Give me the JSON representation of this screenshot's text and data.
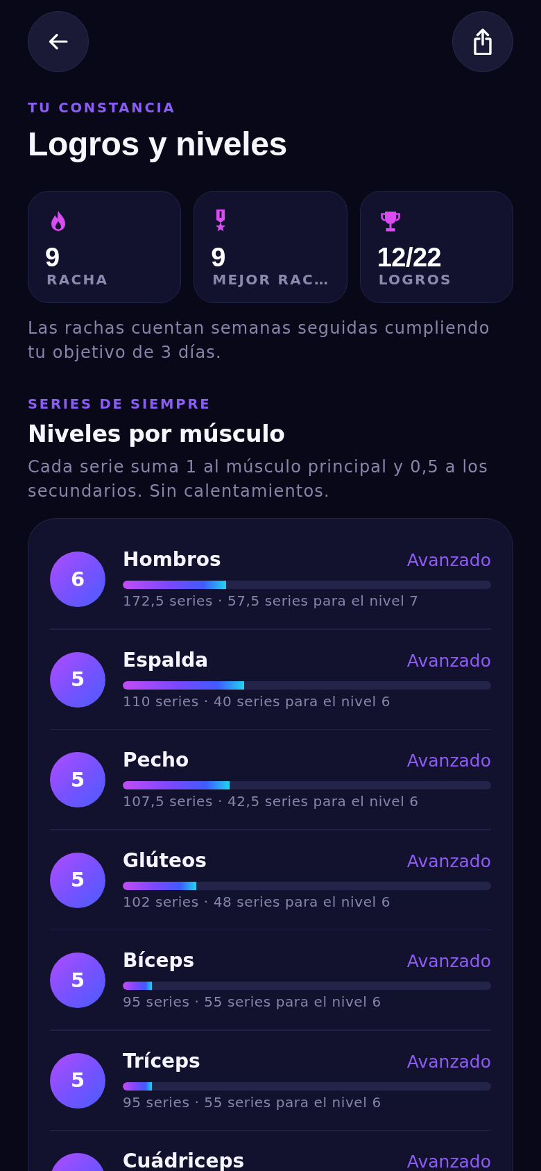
{
  "header": {
    "buttons": [
      {
        "kind": "back"
      },
      {
        "kind": "share"
      }
    ]
  },
  "intro": {
    "eyebrow": "TU CONSTANCIA",
    "title": "Logros y niveles"
  },
  "stats": [
    {
      "kind": "streak",
      "value": "9",
      "label": "RACHA"
    },
    {
      "kind": "best_streak",
      "value": "9",
      "label": "MEJOR RAC…"
    },
    {
      "kind": "achievements",
      "value": "12/22",
      "label": "LOGROS"
    }
  ],
  "stats_note": "Las rachas cuentan semanas seguidas cumpliendo tu objetivo de 3 días.",
  "muscle_levels": {
    "eyebrow": "SERIES DE SIEMPRE",
    "title": "Niveles por músculo",
    "description": "Cada serie suma 1 al músculo principal y 0,5 a los secundarios. Sin calentamientos.",
    "items": [
      {
        "badge": "6",
        "name": "Hombros",
        "tier": "Avanzado",
        "level": 0.28,
        "progress": "172,5 series · 57,5 series para el nivel 7"
      },
      {
        "badge": "5",
        "name": "Espalda",
        "tier": "Avanzado",
        "level": 0.33,
        "progress": "110 series · 40 series para el nivel 6"
      },
      {
        "badge": "5",
        "name": "Pecho",
        "tier": "Avanzado",
        "level": 0.29,
        "progress": "107,5 series · 42,5 series para el nivel 6"
      },
      {
        "badge": "5",
        "name": "Glúteos",
        "tier": "Avanzado",
        "level": 0.2,
        "progress": "102 series · 48 series para el nivel 6"
      },
      {
        "badge": "5",
        "name": "Bíceps",
        "tier": "Avanzado",
        "level": 0.08,
        "progress": "95 series · 55 series para el nivel 6"
      },
      {
        "badge": "5",
        "name": "Tríceps",
        "tier": "Avanzado",
        "level": 0.08,
        "progress": "95 series · 55 series para el nivel 6"
      },
      {
        "name": "Cuádriceps",
        "tier": "Avanzado"
      }
    ]
  }
}
